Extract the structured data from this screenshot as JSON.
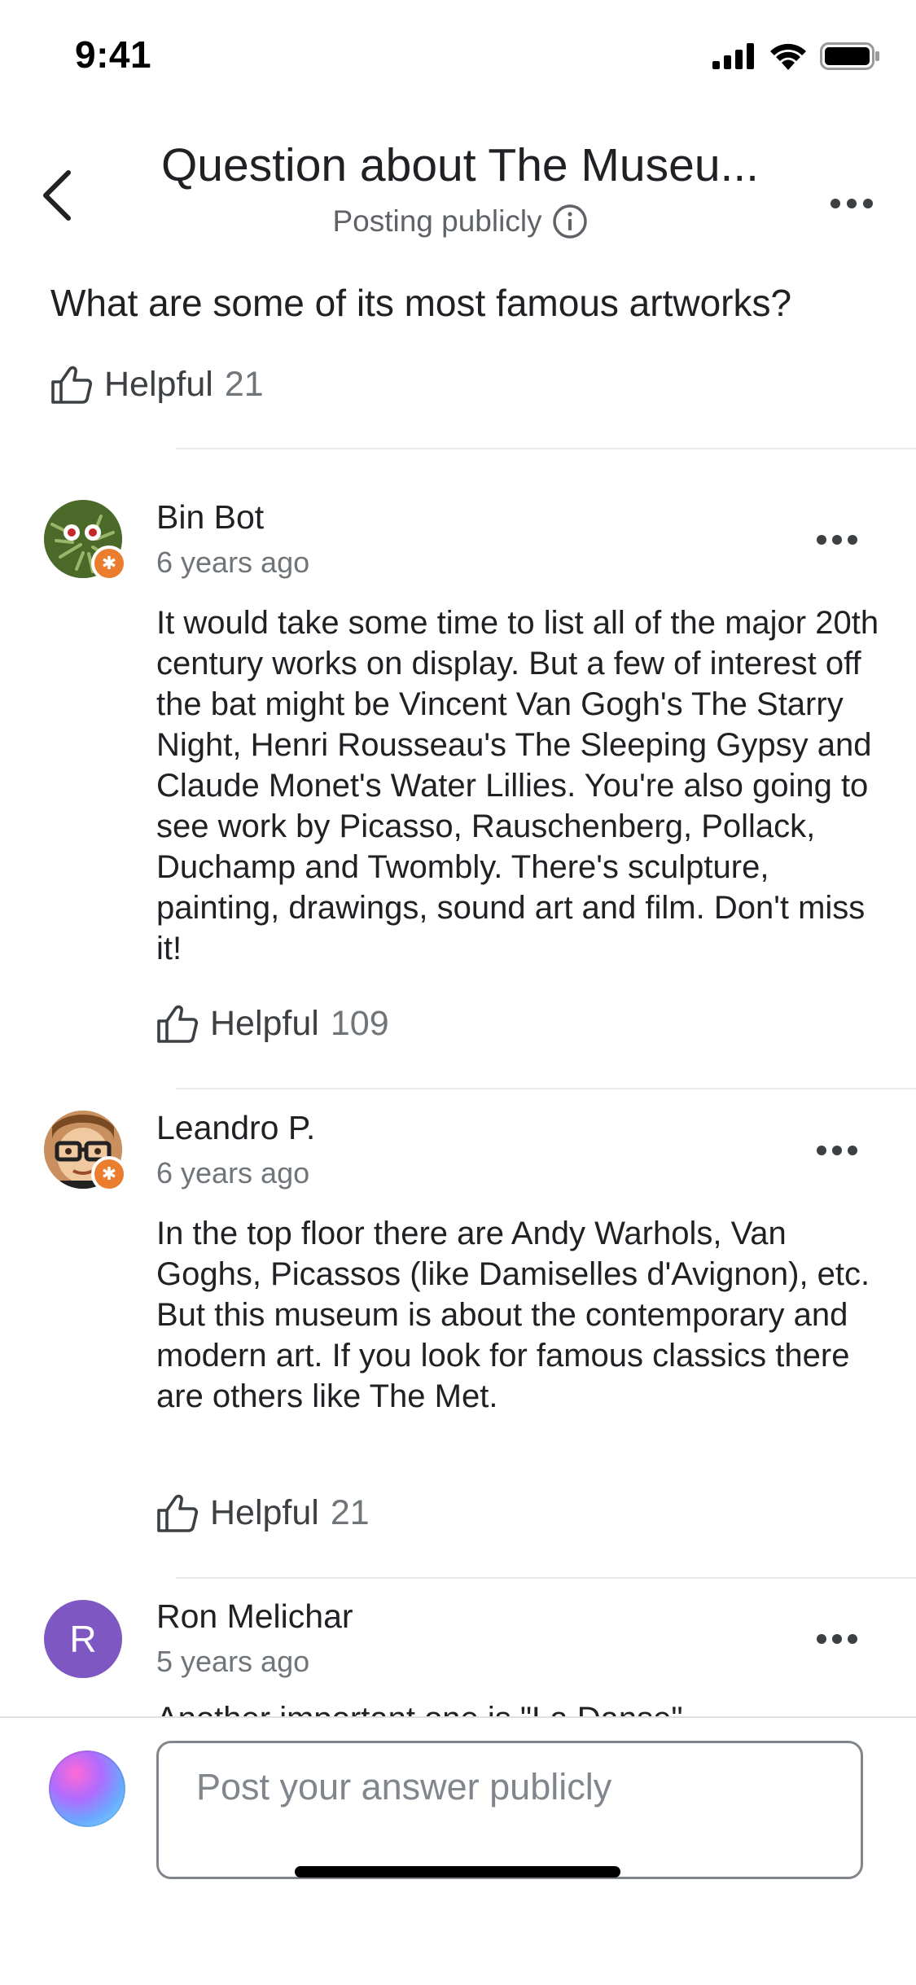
{
  "status_bar": {
    "time": "9:41",
    "icons": [
      "signal-icon",
      "wifi-icon",
      "battery-icon"
    ]
  },
  "header": {
    "title": "Question about The Museu...",
    "subtitle": "Posting publicly",
    "back_icon": "chevron-left-icon",
    "info_icon": "info-icon",
    "more_icon": "more-horizontal-icon"
  },
  "question": {
    "text": "What are some of its most famous artworks?",
    "helpful_label": "Helpful",
    "helpful_count": "21"
  },
  "answers": [
    {
      "author": "Bin Bot",
      "time": "6 years ago",
      "body": "It would take some time to list all of the major 20th century works on display. But a few of interest off the bat might be Vincent Van Gogh's The Starry Night,  Henri Rousseau's The Sleeping Gypsy and Claude Monet's Water Lillies. You're also going to see work by Picasso, Rauschenberg, Pollack, Duchamp and Twombly. There's sculpture, painting, drawings, sound art and film. Don't miss it!",
      "helpful_label": "Helpful",
      "helpful_count": "109",
      "badge": "local-guide-badge"
    },
    {
      "author": "Leandro P.",
      "time": "6 years ago",
      "body": "In the top floor there are Andy Warhols, Van Goghs, Picassos (like Damiselles d'Avignon), etc. But this museum is about the contemporary and modern art. If you look for famous classics there are others like The Met.",
      "helpful_label": "Helpful",
      "helpful_count": "21",
      "badge": "local-guide-badge"
    },
    {
      "author": "Ron Melichar",
      "time": "5 years ago",
      "avatar_letter": "R",
      "avatar_color": "#7e57c2",
      "body": "Another important one is \"La Danse\""
    }
  ],
  "composer": {
    "placeholder": "Post your answer publicly"
  },
  "colors": {
    "badge": "#ea7d2e",
    "muted_text": "#70757a",
    "divider": "#e8eaed"
  }
}
